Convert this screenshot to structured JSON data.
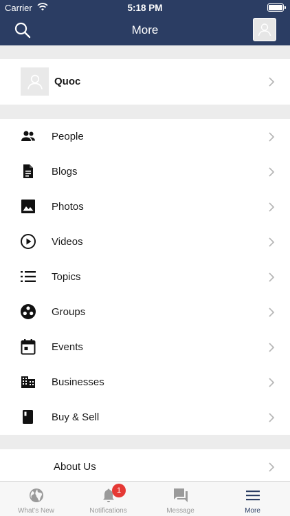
{
  "status_bar": {
    "carrier": "Carrier",
    "time": "5:18 PM"
  },
  "nav": {
    "title": "More",
    "search_icon": "search-icon",
    "avatar_icon": "user-avatar-icon"
  },
  "profile": {
    "name": "Quoc"
  },
  "menu": [
    {
      "label": "People",
      "icon": "people-icon"
    },
    {
      "label": "Blogs",
      "icon": "document-icon"
    },
    {
      "label": "Photos",
      "icon": "photo-icon"
    },
    {
      "label": "Videos",
      "icon": "play-circle-icon"
    },
    {
      "label": "Topics",
      "icon": "list-icon"
    },
    {
      "label": "Groups",
      "icon": "groups-icon"
    },
    {
      "label": "Events",
      "icon": "calendar-icon"
    },
    {
      "label": "Businesses",
      "icon": "building-icon"
    },
    {
      "label": "Buy & Sell",
      "icon": "book-icon"
    }
  ],
  "about": {
    "label": "About Us"
  },
  "tabs": [
    {
      "label": "What's New",
      "icon": "globe-icon",
      "active": false
    },
    {
      "label": "Notifications",
      "icon": "bell-icon",
      "active": false,
      "badge": "1"
    },
    {
      "label": "Message",
      "icon": "chat-icon",
      "active": false
    },
    {
      "label": "More",
      "icon": "menu-icon",
      "active": true
    }
  ],
  "colors": {
    "nav_bg": "#2b3d63",
    "badge": "#e53935",
    "tab_active": "#2b3d63",
    "tab_inactive": "#9a9a9a",
    "page_bg": "#ececec"
  }
}
